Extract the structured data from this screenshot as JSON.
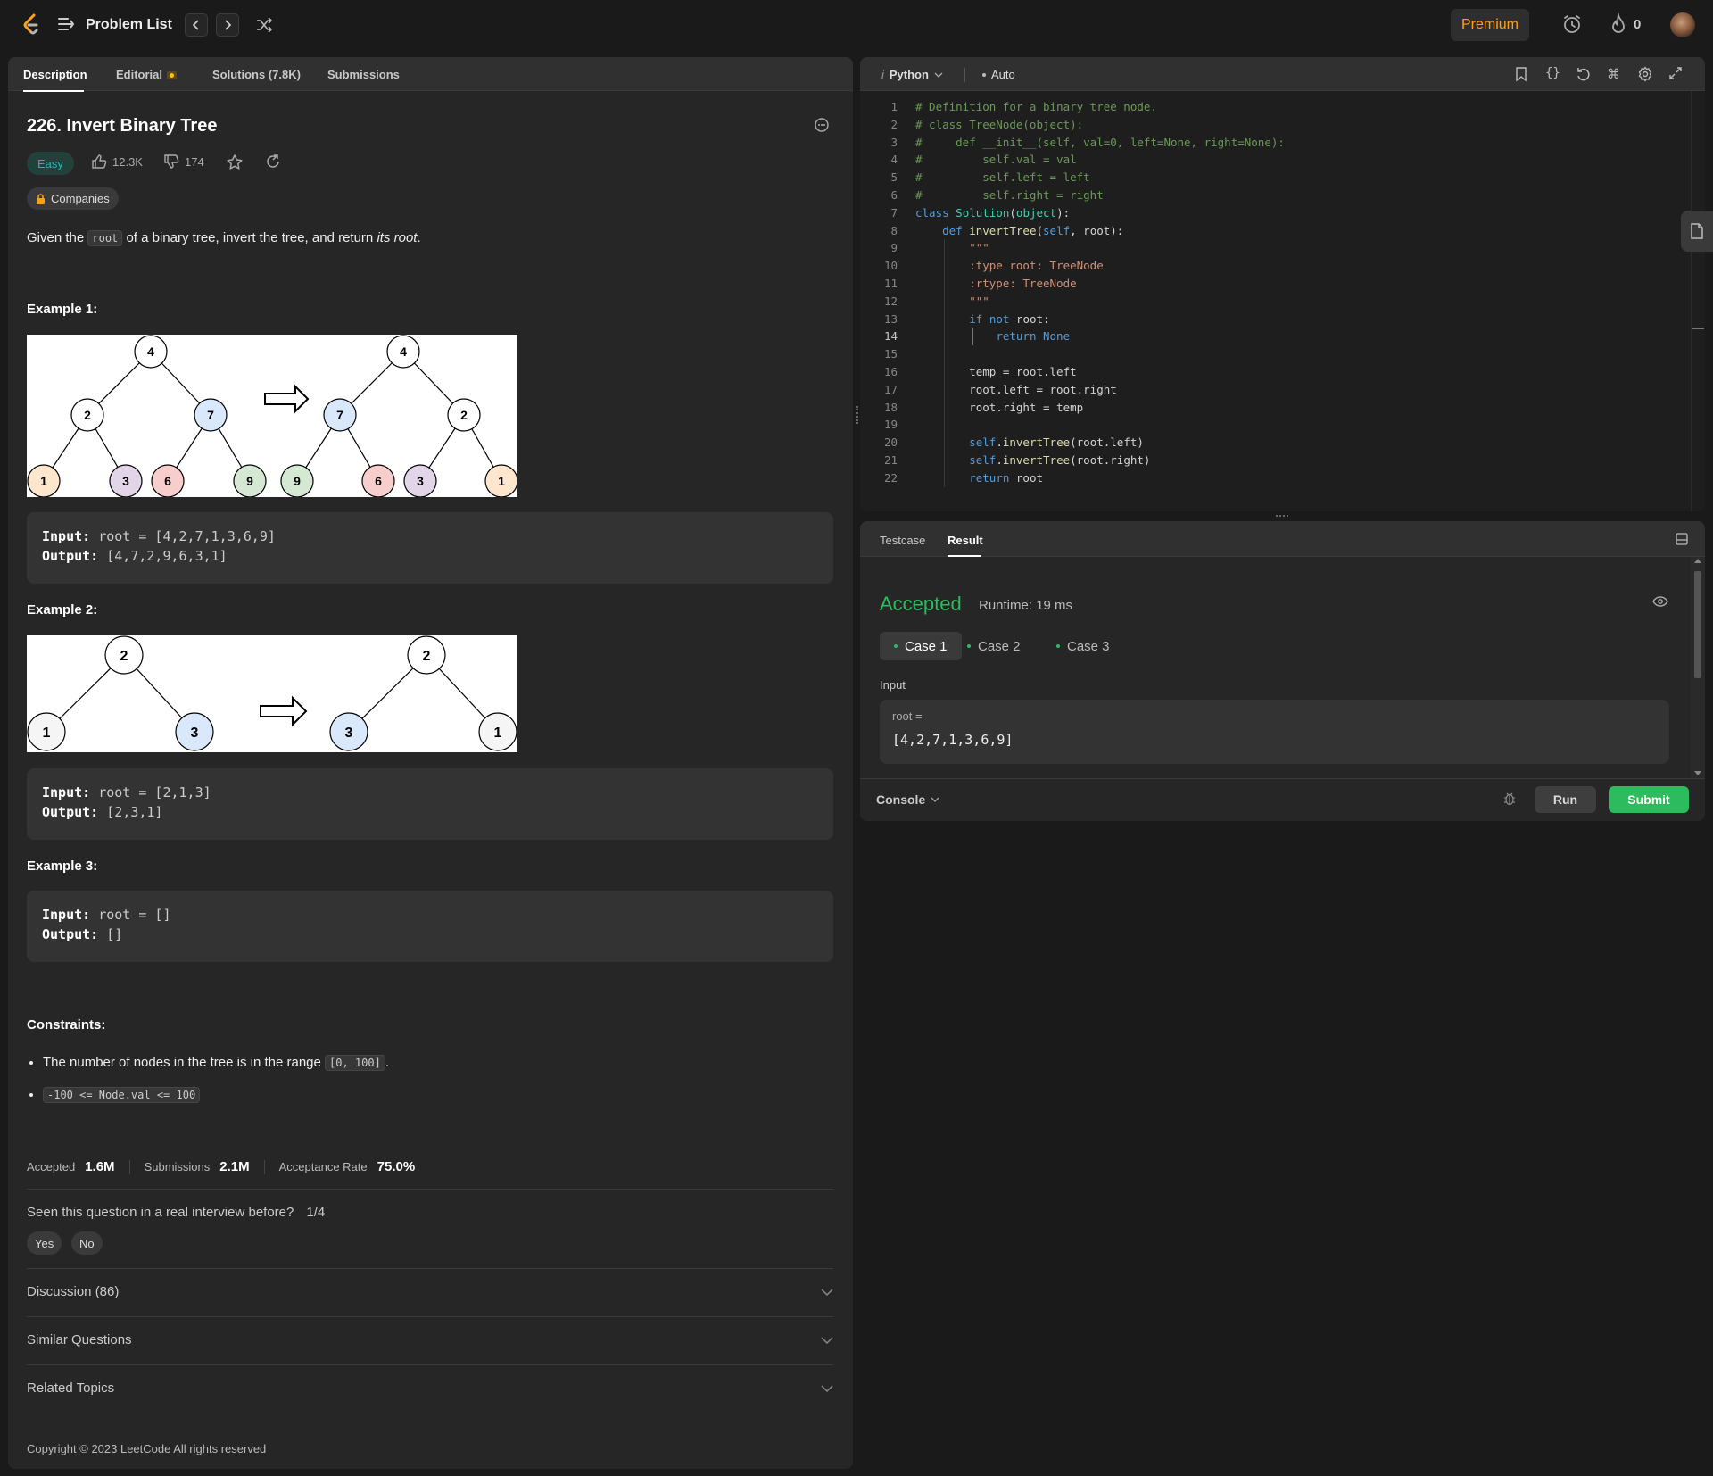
{
  "topbar": {
    "problem_list": "Problem List",
    "premium": "Premium",
    "streak": "0"
  },
  "tabs": {
    "description": "Description",
    "editorial": "Editorial",
    "solutions": "Solutions (7.8K)",
    "submissions": "Submissions"
  },
  "problem": {
    "title": "226. Invert Binary Tree",
    "difficulty": "Easy",
    "likes": "12.3K",
    "dislikes": "174",
    "companies": "Companies",
    "desc_pre": "Given the ",
    "desc_code": "root",
    "desc_mid": " of a binary tree, invert the tree, and return ",
    "desc_em": "its root",
    "desc_end": "."
  },
  "examples": [
    {
      "heading": "Example 1:",
      "input_label": "Input:",
      "input": "root = [4,2,7,1,3,6,9]",
      "output_label": "Output:",
      "output": "[4,7,2,9,6,3,1]"
    },
    {
      "heading": "Example 2:",
      "input_label": "Input:",
      "input": "root = [2,1,3]",
      "output_label": "Output:",
      "output": "[2,3,1]"
    },
    {
      "heading": "Example 3:",
      "input_label": "Input:",
      "input": "root = []",
      "output_label": "Output:",
      "output": "[]"
    }
  ],
  "diagram1": {
    "before": {
      "root": "4",
      "l": "2",
      "r": "7",
      "ll": "1",
      "lr": "3",
      "rl": "6",
      "rr": "9"
    },
    "after": {
      "root": "4",
      "l": "7",
      "r": "2",
      "ll": "9",
      "lr": "6",
      "rl": "3",
      "rr": "1"
    }
  },
  "diagram2": {
    "before": {
      "root": "2",
      "l": "1",
      "r": "3"
    },
    "after": {
      "root": "2",
      "l": "3",
      "r": "1"
    }
  },
  "constraints": {
    "heading": "Constraints:",
    "c1_text": "The number of nodes in the tree is in the range ",
    "c1_code": "[0, 100]",
    "c1_end": ".",
    "c2_code": "-100 <= Node.val <= 100"
  },
  "stats": {
    "accepted_label": "Accepted",
    "accepted": "1.6M",
    "submissions_label": "Submissions",
    "submissions": "2.1M",
    "rate_label": "Acceptance Rate",
    "rate": "75.0%"
  },
  "interview": {
    "question": "Seen this question in a real interview before?",
    "count": "1/4",
    "yes": "Yes",
    "no": "No"
  },
  "accordions": {
    "discussion": "Discussion (86)",
    "similar": "Similar Questions",
    "topics": "Related Topics"
  },
  "copyright": "Copyright © 2023 LeetCode All rights reserved",
  "editor": {
    "language": "Python",
    "mode": "Auto",
    "line_numbers": [
      "1",
      "2",
      "3",
      "4",
      "5",
      "6",
      "7",
      "8",
      "9",
      "10",
      "11",
      "12",
      "13",
      "14",
      "15",
      "16",
      "17",
      "18",
      "19",
      "20",
      "21",
      "22"
    ],
    "lines": [
      "# Definition for a binary tree node.",
      "# class TreeNode(object):",
      "#     def __init__(self, val=0, left=None, right=None):",
      "#         self.val = val",
      "#         self.left = left",
      "#         self.right = right",
      "class Solution(object):",
      "    def invertTree(self, root):",
      "        \"\"\"",
      "        :type root: TreeNode",
      "        :rtype: TreeNode",
      "        \"\"\"",
      "        if not root:",
      "            return None",
      "",
      "        temp = root.left",
      "        root.left = root.right",
      "        root.right = temp",
      "",
      "        self.invertTree(root.left)",
      "        self.invertTree(root.right)",
      "        return root"
    ]
  },
  "result": {
    "tab_testcase": "Testcase",
    "tab_result": "Result",
    "status": "Accepted",
    "runtime": "Runtime: 19 ms",
    "cases": [
      "Case 1",
      "Case 2",
      "Case 3"
    ],
    "input_label": "Input",
    "input_var": "root =",
    "input_val": "[4,2,7,1,3,6,9]",
    "console": "Console",
    "run": "Run",
    "submit": "Submit"
  },
  "colors": {
    "accent": "#ffa116",
    "easy": "#1cbaba",
    "accepted": "#2cbb5d",
    "submit": "#2cbb5d"
  }
}
